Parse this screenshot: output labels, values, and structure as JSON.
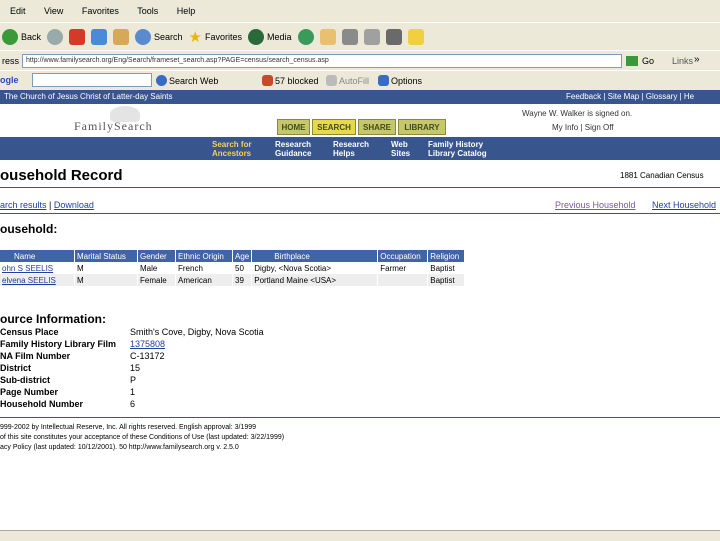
{
  "browser": {
    "menu": [
      "Edit",
      "View",
      "Favorites",
      "Tools",
      "Help"
    ],
    "toolbar": {
      "back": "Back",
      "search": "Search",
      "favorites": "Favorites",
      "media": "Media"
    },
    "address_label": "ress",
    "address": "http://www.familysearch.org/Eng/Search/frameset_search.asp?PAGE=census/search_census.asp",
    "go": "Go",
    "links": "Links",
    "chevron": "»",
    "google_label": "ogle",
    "google_search": "Search Web",
    "blocked": "57 blocked",
    "autofill": "AutoFill",
    "options": "Options"
  },
  "site": {
    "church_bar": "The Church of Jesus Christ of Latter-day Saints",
    "top_links": [
      "Feedback",
      "Site Map",
      "Glossary",
      "He"
    ],
    "logo": "FamilySearch",
    "signed_in": "Wayne W. Walker is signed on.",
    "account_links": [
      "My Info",
      "Sign Off"
    ],
    "tabs": [
      "HOME",
      "SEARCH",
      "SHARE",
      "LIBRARY"
    ],
    "subnav": [
      {
        "line1": "Search for",
        "line2": "Ancestors"
      },
      {
        "line1": "Research",
        "line2": "Guidance"
      },
      {
        "line1": "Research",
        "line2": "Helps"
      },
      {
        "line1": "Web",
        "line2": "Sites"
      },
      {
        "line1": "Family History",
        "line2": "Library Catalog"
      }
    ]
  },
  "page": {
    "title": "ousehold Record",
    "census_name": "1881 Canadian Census",
    "links_left": [
      "arch results",
      "Download"
    ],
    "prev": "Previous Household",
    "next": "Next Household",
    "household_heading": "ousehold:",
    "columns": [
      "Name",
      "Marital Status",
      "Gender",
      "Ethnic Origin",
      "Age",
      "Birthplace",
      "Occupation",
      "Religion"
    ],
    "rows": [
      [
        "ohn S SEELIS",
        "M",
        "Male",
        "French",
        "50",
        "Digby, <Nova Scotia>",
        "Farmer",
        "Baptist"
      ],
      [
        "elvena SEELIS",
        "M",
        "Female",
        "American",
        "39",
        "Portland Maine <USA>",
        "",
        "Baptist"
      ]
    ],
    "source_heading": "ource Information:",
    "source": [
      {
        "label": "Census Place",
        "value": "Smith's Cove, Digby, Nova Scotia",
        "link": false
      },
      {
        "label": "Family History Library Film",
        "value": "1375808",
        "link": true
      },
      {
        "label": "NA Film Number",
        "value": "C-13172",
        "link": false
      },
      {
        "label": "District",
        "value": "15",
        "link": false
      },
      {
        "label": "Sub-district",
        "value": "P",
        "link": false
      },
      {
        "label": "Page Number",
        "value": "1",
        "link": false
      },
      {
        "label": "Household Number",
        "value": "6",
        "link": false
      }
    ],
    "footer": [
      "999-2002 by Intellectual Reserve, Inc. All rights reserved. English approval: 3/1999",
      "of this site constitutes your acceptance of these Conditions of Use (last updated: 3/22/1999)",
      "acy Policy (last updated: 10/12/2001). 50 http://www.familysearch.org v. 2.5.0"
    ]
  }
}
